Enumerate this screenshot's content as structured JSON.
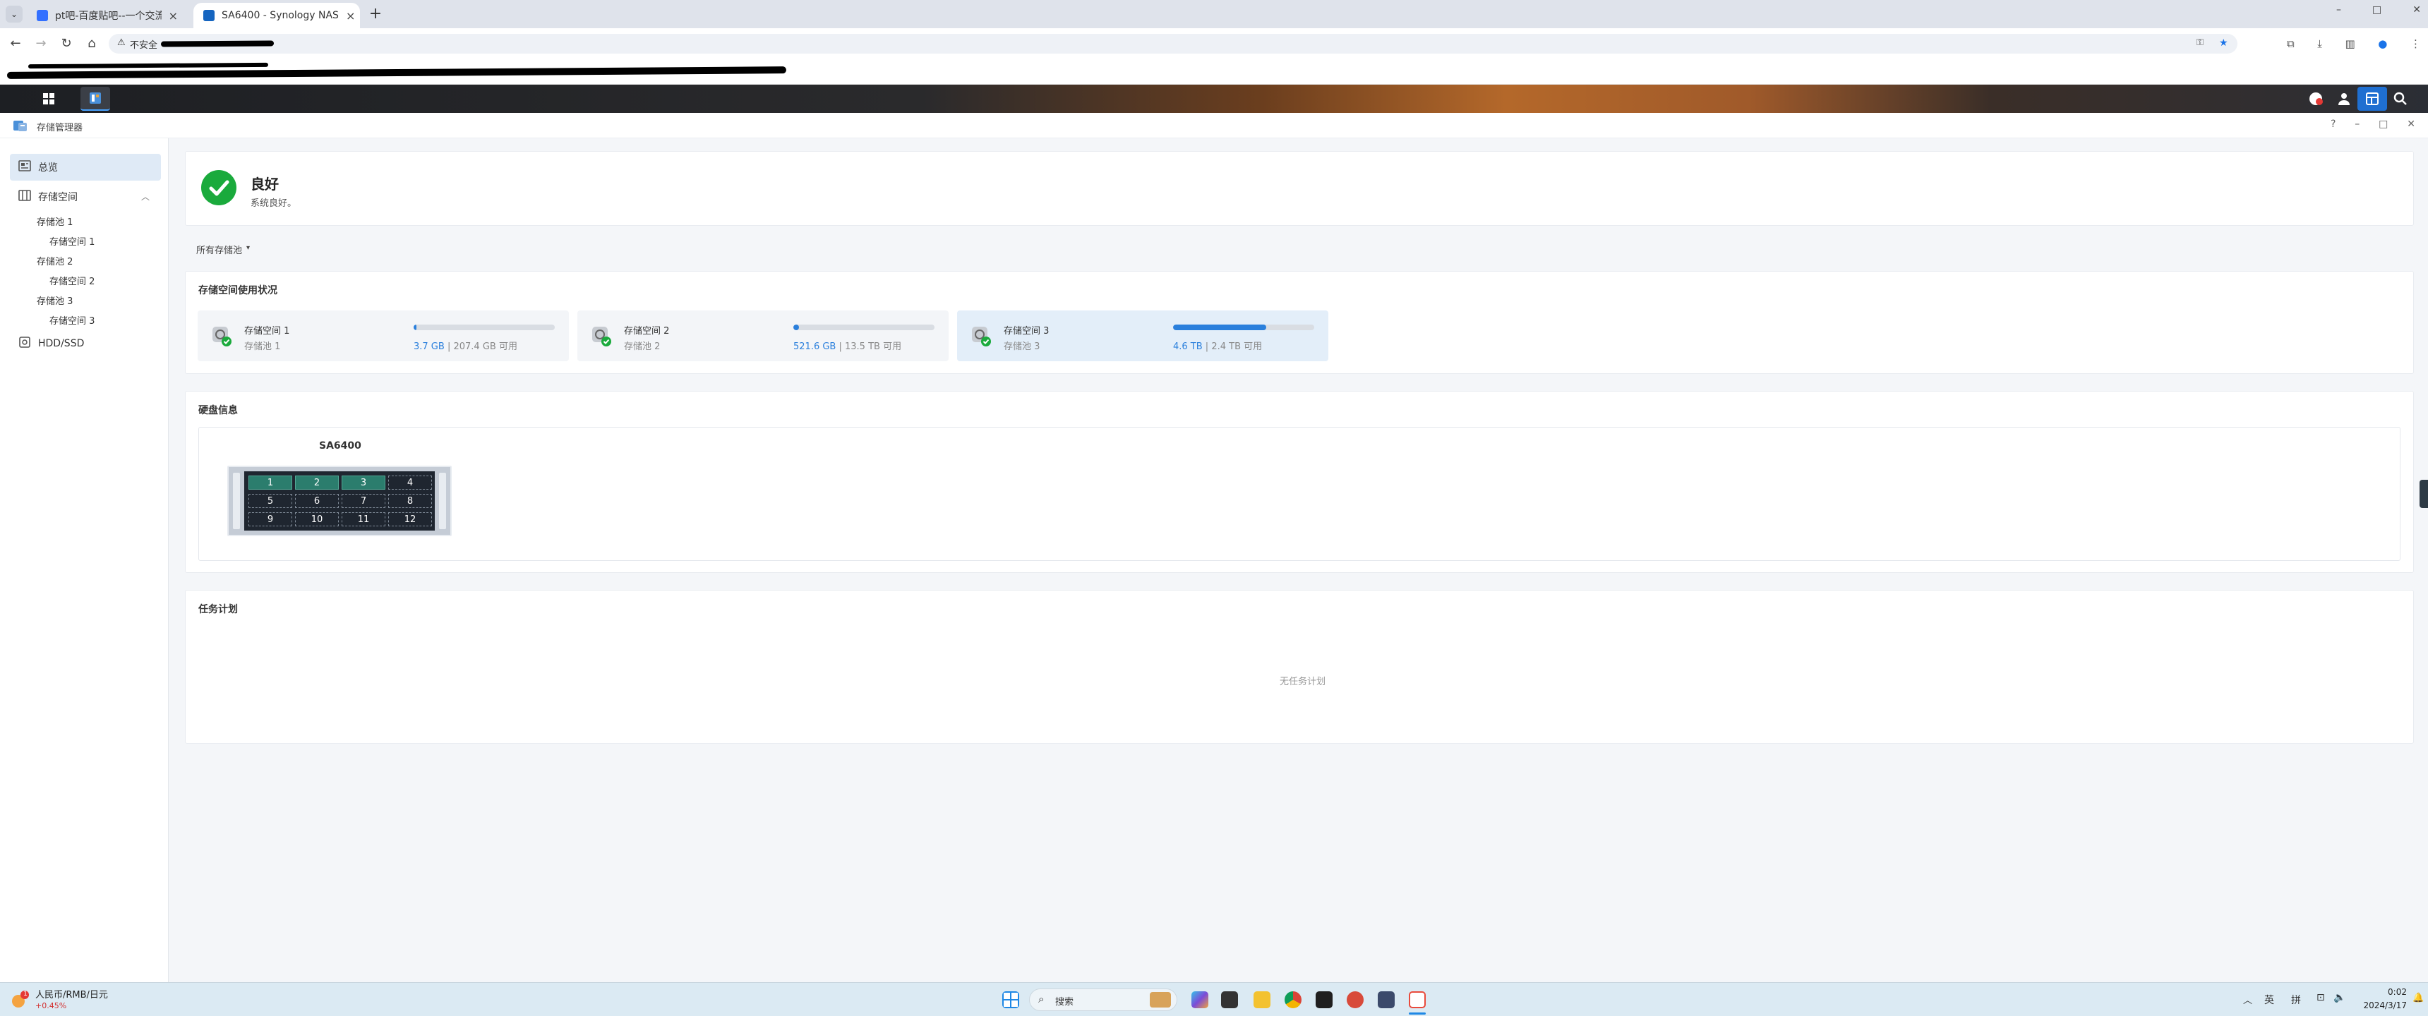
{
  "browser": {
    "tabs": [
      {
        "title": "pt吧-百度贴吧--一个交流PT资",
        "active": false
      },
      {
        "title": "SA6400 - Synology NAS",
        "active": true
      }
    ],
    "new_tab": "+",
    "address_prefix": "不安全",
    "window_controls": [
      "–",
      "□",
      "✕"
    ]
  },
  "window": {
    "title": "存储管理器",
    "controls": [
      "?",
      "–",
      "□",
      "✕"
    ]
  },
  "sidebar": {
    "items": [
      {
        "label": "总览",
        "level": 0,
        "icon": "overview-icon",
        "selected": true
      },
      {
        "label": "存储空间",
        "level": 0,
        "icon": "storage-icon",
        "expanded": true
      },
      {
        "label": "存储池 1",
        "level": 1
      },
      {
        "label": "存储空间 1",
        "level": 2
      },
      {
        "label": "存储池 2",
        "level": 1
      },
      {
        "label": "存储空间 2",
        "level": 2
      },
      {
        "label": "存储池 3",
        "level": 1
      },
      {
        "label": "存储空间 3",
        "level": 2
      },
      {
        "label": "HDD/SSD",
        "level": 0,
        "icon": "hdd-icon"
      }
    ]
  },
  "status": {
    "title": "良好",
    "subtitle": "系统良好。",
    "color": "#1aaa3c"
  },
  "filter": {
    "label": "所有存储池"
  },
  "usage": {
    "heading": "存储空间使用状况",
    "volumes": [
      {
        "name": "存储空间 1",
        "pool": "存储池 1",
        "used": "3.7 GB",
        "available": "207.4 GB 可用",
        "fill": 0.02
      },
      {
        "name": "存储空间 2",
        "pool": "存储池 2",
        "used": "521.6 GB",
        "available": "13.5 TB 可用",
        "fill": 0.04
      },
      {
        "name": "存储空间 3",
        "pool": "存储池 3",
        "used": "4.6 TB",
        "available": "2.4 TB 可用",
        "fill": 0.66
      }
    ]
  },
  "disk_info": {
    "heading": "硬盘信息",
    "model": "SA6400",
    "bays": [
      {
        "label": "1",
        "used": true
      },
      {
        "label": "2",
        "used": true
      },
      {
        "label": "3",
        "used": true
      },
      {
        "label": "4",
        "used": false
      },
      {
        "label": "5",
        "used": false
      },
      {
        "label": "6",
        "used": false
      },
      {
        "label": "7",
        "used": false
      },
      {
        "label": "8",
        "used": false
      },
      {
        "label": "9",
        "used": false
      },
      {
        "label": "10",
        "used": false
      },
      {
        "label": "11",
        "used": false
      },
      {
        "label": "12",
        "used": false
      }
    ]
  },
  "tasks": {
    "heading": "任务计划",
    "empty": "无任务计划"
  },
  "taskbar": {
    "widget_title": "人民币/RMB/日元",
    "widget_change": "+0.45%",
    "widget_badge": "1",
    "search_placeholder": "搜索",
    "ime_lang": "英",
    "ime_mode": "拼",
    "time": "0:02",
    "date": "2024/3/17"
  }
}
